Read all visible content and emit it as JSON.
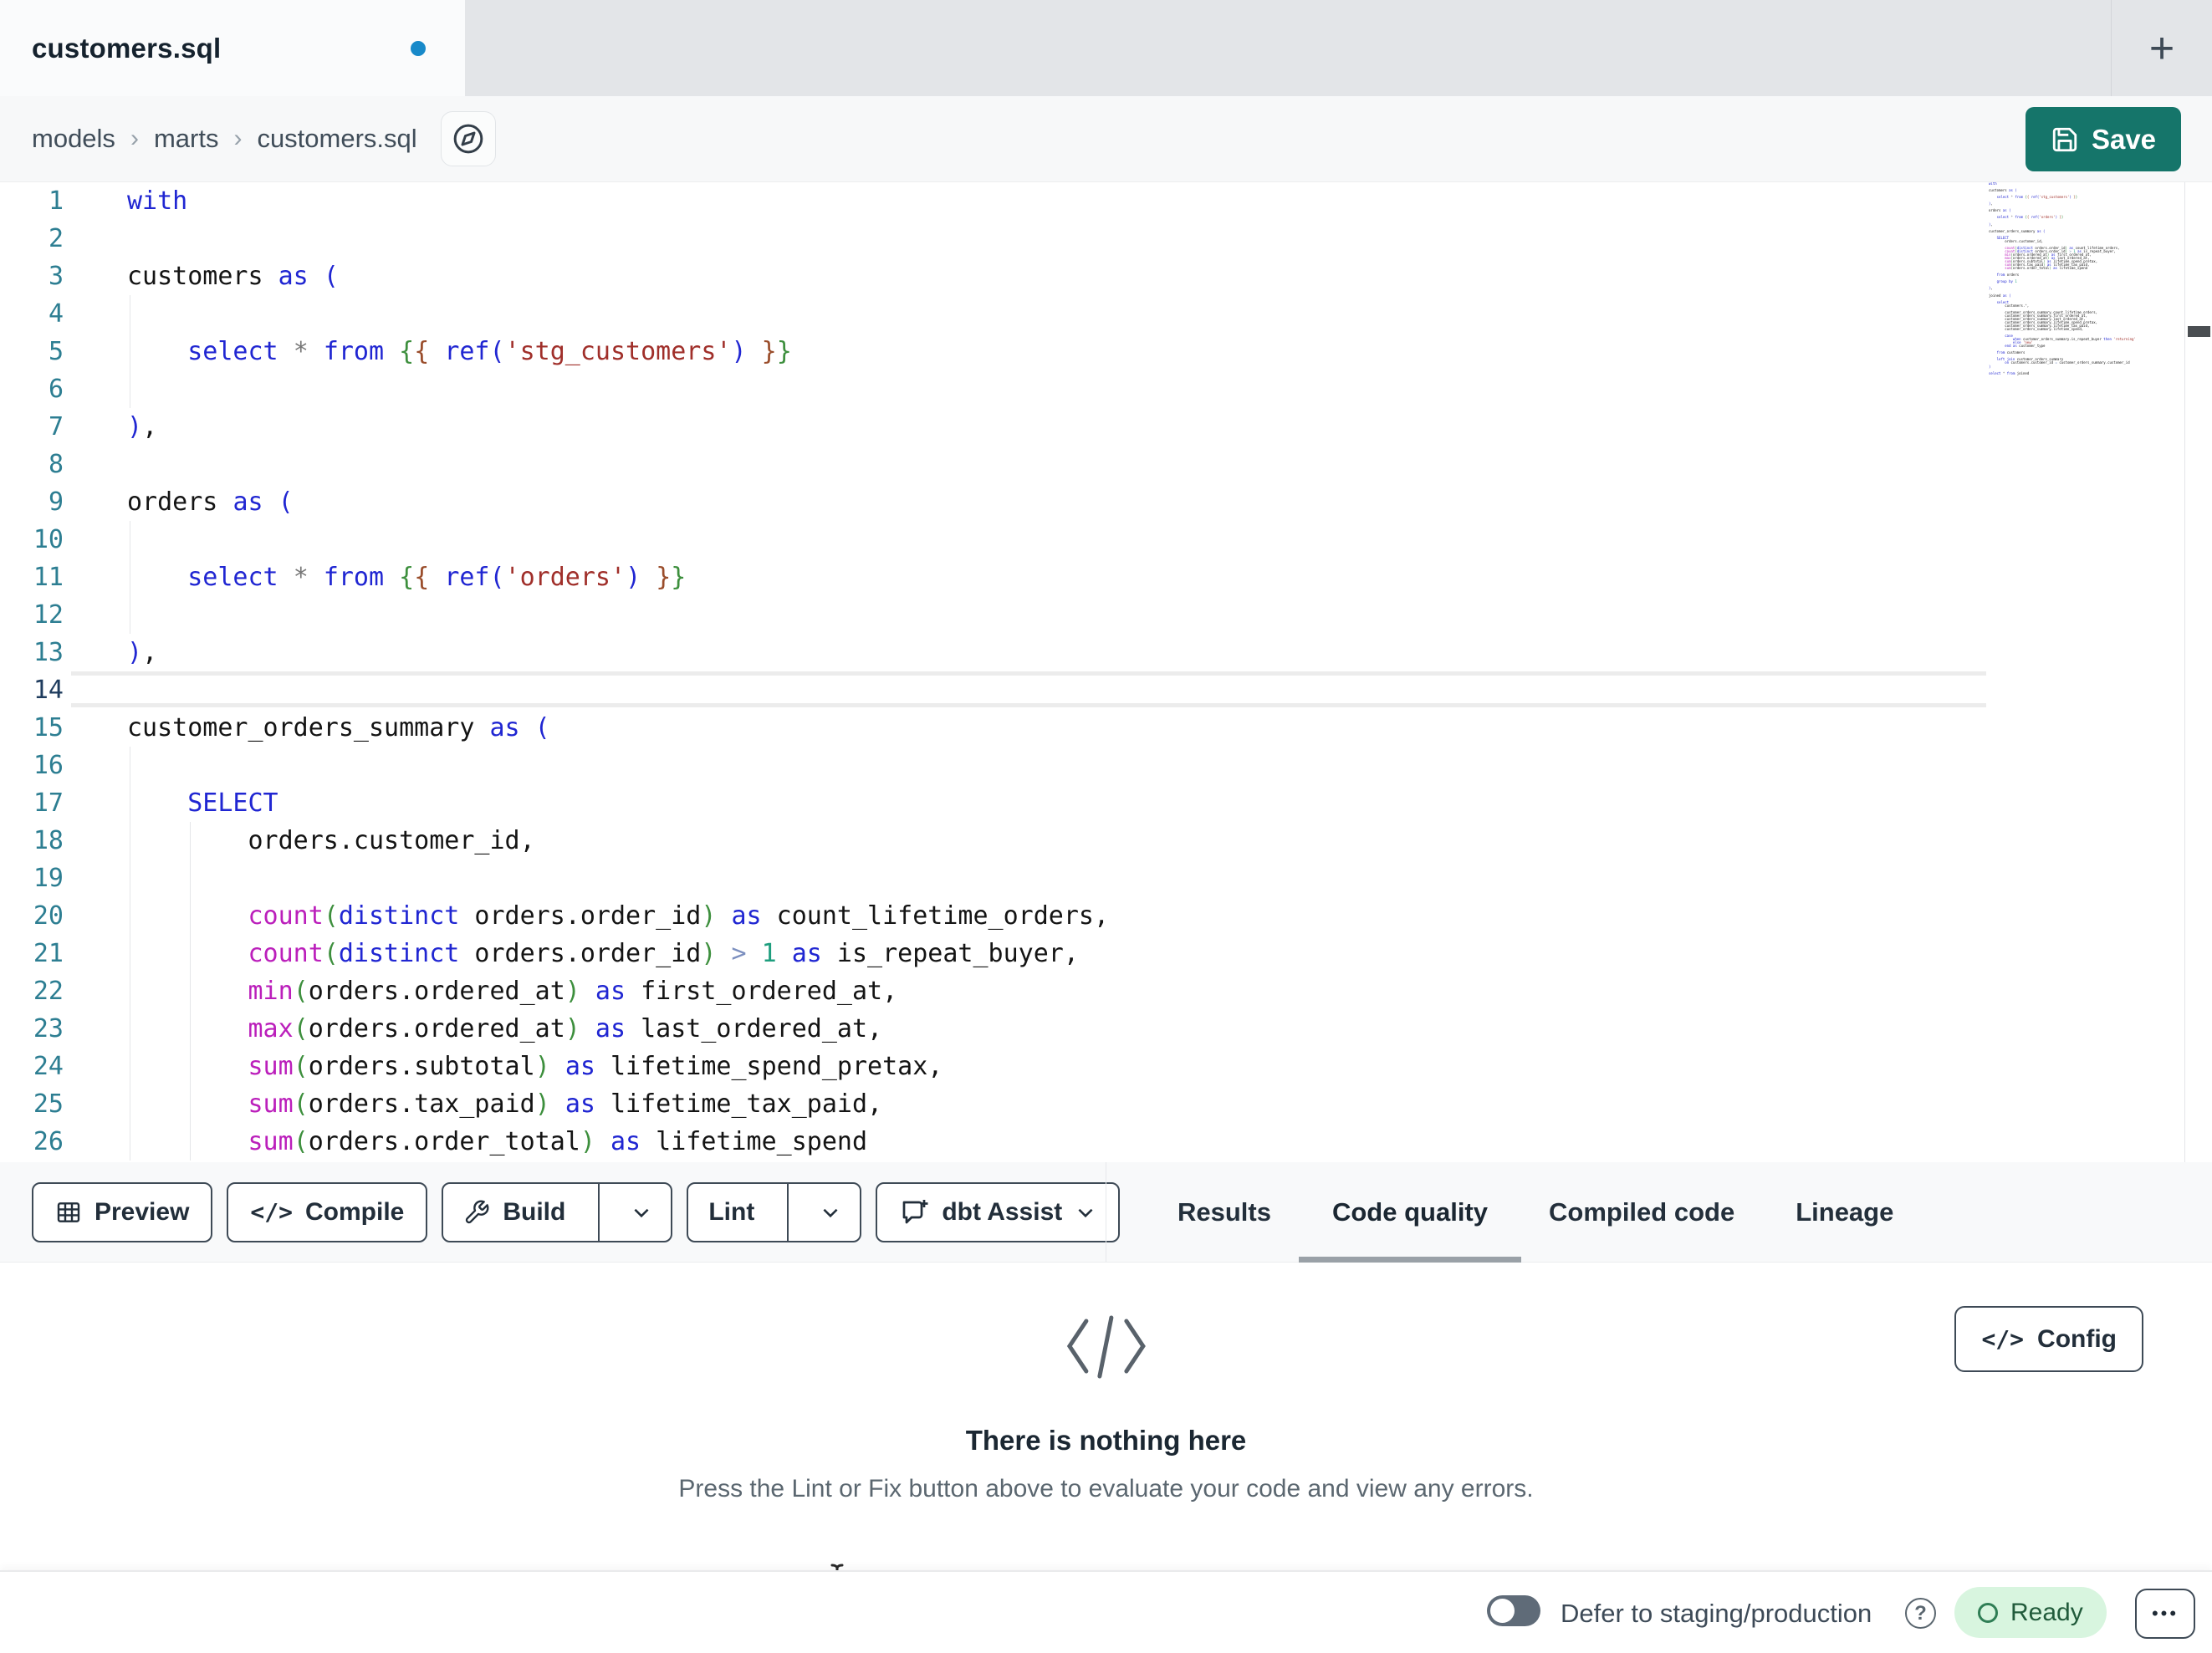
{
  "tab_bar": {
    "active_tab_label": "customers.sql",
    "new_tab_glyph": "+"
  },
  "breadcrumb": {
    "items": [
      "models",
      "marts",
      "customers.sql"
    ],
    "separator": "›"
  },
  "save_button": {
    "label": "Save"
  },
  "editor": {
    "active_line": 14,
    "lines": [
      "with",
      "",
      "customers as (",
      "",
      "    select * from {{ ref('stg_customers') }}",
      "",
      "),",
      "",
      "orders as (",
      "",
      "    select * from {{ ref('orders') }}",
      "",
      "),",
      "",
      "customer_orders_summary as (",
      "",
      "    SELECT",
      "        orders.customer_id,",
      "",
      "        count(distinct orders.order_id) as count_lifetime_orders,",
      "        count(distinct orders.order_id) > 1 as is_repeat_buyer,",
      "        min(orders.ordered_at) as first_ordered_at,",
      "        max(orders.ordered_at) as last_ordered_at,",
      "        sum(orders.subtotal) as lifetime_spend_pretax,",
      "        sum(orders.tax_paid) as lifetime_tax_paid,",
      "        sum(orders.order_total) as lifetime_spend"
    ],
    "indent_guides": {
      "col1_rows": [
        4,
        5,
        6,
        10,
        11,
        12,
        16,
        17,
        18,
        19,
        20,
        21,
        22,
        23,
        24,
        25,
        26
      ],
      "col2_rows": [
        18,
        19,
        20,
        21,
        22,
        23,
        24,
        25,
        26
      ]
    }
  },
  "minimap": {
    "lines": [
      "with",
      "",
      "customers as (",
      "",
      "    select * from {{ ref('stg_customers') }}",
      "",
      "),",
      "",
      "orders as (",
      "",
      "    select * from {{ ref('orders') }}",
      "",
      "),",
      "",
      "customer_orders_summary as (",
      "",
      "    SELECT",
      "        orders.customer_id,",
      "",
      "        count(distinct orders.order_id) as count_lifetime_orders,",
      "        count(distinct orders.order_id) > 1 as is_repeat_buyer,",
      "        min(orders.ordered_at) as first_ordered_at,",
      "        max(orders.ordered_at) as last_ordered_at,",
      "        sum(orders.subtotal) as lifetime_spend_pretax,",
      "        sum(orders.tax_paid) as lifetime_tax_paid,",
      "        sum(orders.order_total) as lifetime_spend",
      "",
      "    from orders",
      "",
      "    group by 1",
      "",
      "),",
      "",
      "joined as (",
      "",
      "    select",
      "        customers.*,",
      "",
      "        customer_orders_summary.count_lifetime_orders,",
      "        customer_orders_summary.first_ordered_at,",
      "        customer_orders_summary.last_ordered_at,",
      "        customer_orders_summary.lifetime_spend_pretax,",
      "        customer_orders_summary.lifetime_tax_paid,",
      "        customer_orders_summary.lifetime_spend,",
      "",
      "        case",
      "            when customer_orders_summary.is_repeat_buyer then 'returning'",
      "            else 'new'",
      "        end as customer_type",
      "",
      "    from customers",
      "",
      "    left join customer_orders_summary",
      "        on customers.customer_id = customer_orders_summary.customer_id",
      ")",
      "",
      "select * from joined"
    ]
  },
  "toolbar": {
    "preview": "Preview",
    "compile": "Compile",
    "build": "Build",
    "lint": "Lint",
    "dbt_assist": "dbt Assist"
  },
  "panel_tabs": [
    {
      "label": "Results",
      "active": false
    },
    {
      "label": "Code quality",
      "active": true
    },
    {
      "label": "Compiled code",
      "active": false
    },
    {
      "label": "Lineage",
      "active": false
    }
  ],
  "results_panel": {
    "title": "There is nothing here",
    "subtitle": "Press the Lint or Fix button above to evaluate your code and view any errors.",
    "config_label": "Config",
    "code_glyph": "</>"
  },
  "status_bar": {
    "defer_label": "Defer to staging/production",
    "ready_label": "Ready",
    "more_glyph": "•••"
  },
  "colors": {
    "accent_teal": "#15756A",
    "tab_dirty_dot": "#1789C9",
    "tab_bar_bg": "#E3E5E8",
    "ready_bg": "#D8F5DF",
    "ready_text": "#215B3B",
    "syntax": {
      "keyword": "#2026D2",
      "function": "#BB1FBB",
      "string": "#A02F2A",
      "jinja_outer": "#3D8F3D",
      "jinja_inner": "#9A4D2B",
      "number": "#1E9E7E",
      "operator": "#7B8FBF",
      "default": "#141414",
      "line_number": "#2D7E92",
      "active_line_number": "#1F3C5E"
    }
  }
}
